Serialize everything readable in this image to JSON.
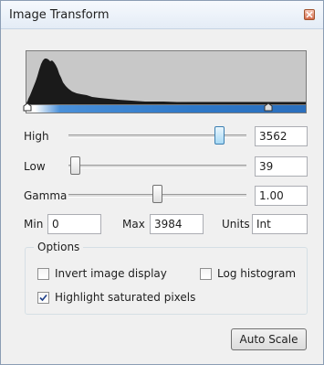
{
  "window": {
    "title": "Image Transform",
    "close_icon": "close-icon"
  },
  "histogram": {
    "shape": "left-skewed peak near low values",
    "fill_color": "#1a1a1a",
    "background_color": "#c8c8c8"
  },
  "gradient_bar": {
    "colors": [
      "#ffffff",
      "#4a90d9",
      "#2b6fbd"
    ],
    "markers": [
      "low-marker",
      "high-marker"
    ]
  },
  "sliders": {
    "high": {
      "label": "High",
      "value": "3562",
      "level": 0.89
    },
    "low": {
      "label": "Low",
      "value": "39",
      "level": 0.01
    },
    "gamma": {
      "label": "Gamma",
      "value": "1.00",
      "level": 0.5
    }
  },
  "range": {
    "min_label": "Min",
    "min_value": "0",
    "max_label": "Max",
    "max_value": "3984",
    "units_label": "Units",
    "units_value": "Int"
  },
  "options": {
    "title": "Options",
    "invert_label": "Invert image display",
    "invert_checked": false,
    "log_label": "Log histogram",
    "log_checked": false,
    "highlight_label": "Highlight saturated pixels",
    "highlight_checked": true
  },
  "actions": {
    "auto_scale_label": "Auto Scale"
  }
}
